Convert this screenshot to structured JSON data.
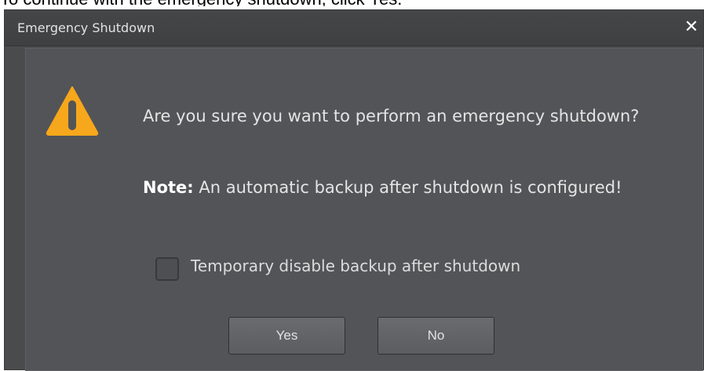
{
  "document": {
    "caption": "To continue with the emergency shutdown, click Yes."
  },
  "dialog": {
    "title": "Emergency Shutdown",
    "close_glyph": "✕",
    "icon": "warning-triangle-icon",
    "message": "Are you sure you want to perform an emergency shutdown?",
    "note_label": "Note:",
    "note_text": " An automatic backup after shutdown is configured!",
    "checkbox_label": "Temporary disable backup after shutdown",
    "checkbox_checked": false,
    "yes_label": "Yes",
    "no_label": "No"
  },
  "colors": {
    "warning": "#f6a71b",
    "dialog_bg": "#4a4b4d",
    "body_bg": "#535457"
  }
}
